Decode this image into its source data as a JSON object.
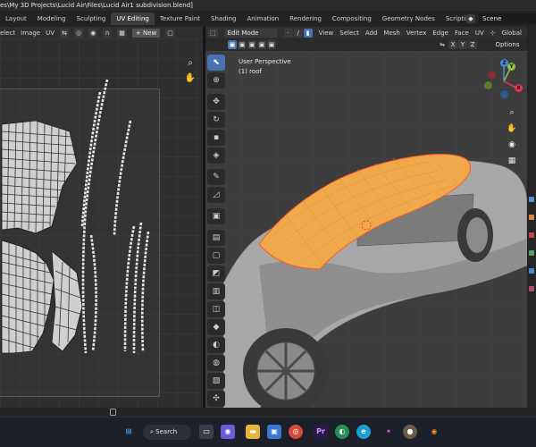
{
  "window": {
    "title": "es\\My 3D Projects\\Lucid Air\\Files\\Lucid Air1 subdivision.blend]"
  },
  "workspaces": {
    "tabs": [
      "Layout",
      "Modeling",
      "Sculpting",
      "UV Editing",
      "Texture Paint",
      "Shading",
      "Animation",
      "Rendering",
      "Compositing",
      "Geometry Nodes",
      "Scripting"
    ],
    "active": "UV Editing",
    "add_label": "+",
    "scene_label": "Scene"
  },
  "uv_editor": {
    "menu": [
      "elect",
      "Image",
      "UV"
    ],
    "new_button": "New"
  },
  "viewport": {
    "mode": "Edit Mode",
    "menu": [
      "View",
      "Select",
      "Add",
      "Mesh",
      "Vertex",
      "Edge",
      "Face",
      "UV"
    ],
    "transform_orientation": "Global",
    "axis_toggles": [
      "X",
      "Y",
      "Z"
    ],
    "options_label": "Options",
    "view_name": "User Perspective",
    "object_name": "(1) roof"
  },
  "gizmo": {
    "x_label": "X",
    "y_label": "Y",
    "z_label": "Z"
  },
  "taskbar": {
    "search_label": "Search"
  },
  "colors": {
    "accent": "#4772b3",
    "selection": "#f5a623",
    "axis_x": "#e8384f",
    "axis_y": "#8cc63f",
    "axis_z": "#3e8ede"
  }
}
